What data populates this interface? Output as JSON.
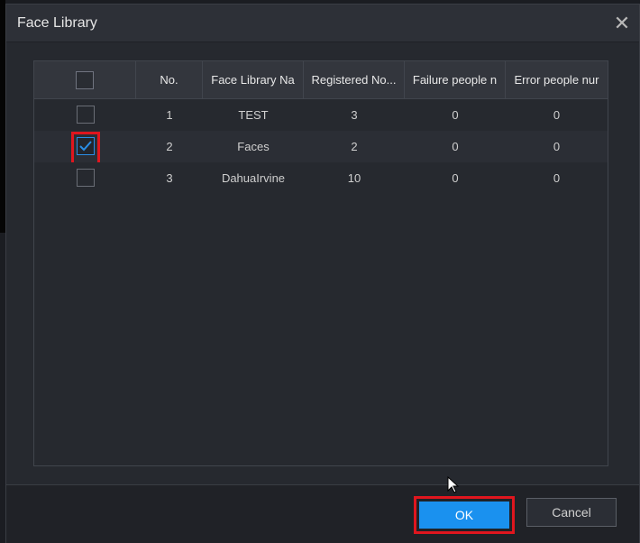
{
  "dialog": {
    "title": "Face Library",
    "close_icon": "close-icon"
  },
  "table": {
    "columns": [
      "",
      "No.",
      "Face Library Na",
      "Registered No...",
      "Failure people n",
      "Error people nur"
    ],
    "rows": [
      {
        "checked": false,
        "no": "1",
        "name": "TEST",
        "registered": "3",
        "failure": "0",
        "error": "0"
      },
      {
        "checked": true,
        "no": "2",
        "name": "Faces",
        "registered": "2",
        "failure": "0",
        "error": "0"
      },
      {
        "checked": false,
        "no": "3",
        "name": "DahuaIrvine",
        "registered": "10",
        "failure": "0",
        "error": "0"
      }
    ]
  },
  "footer": {
    "ok_label": "OK",
    "cancel_label": "Cancel"
  },
  "colors": {
    "accent": "#1a91ef",
    "highlight": "#e0161e",
    "checkbox_checked": "#2a8ee6"
  }
}
